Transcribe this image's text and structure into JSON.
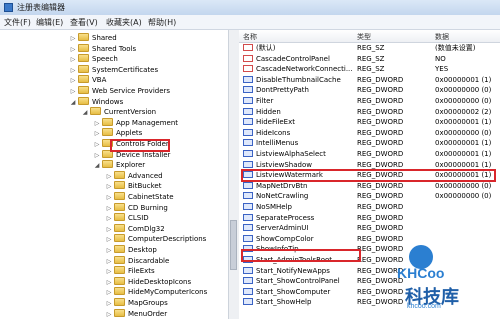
{
  "window": {
    "title": "注册表编辑器"
  },
  "menu": [
    "文件(F)",
    "编辑(E)",
    "查看(V)",
    "收藏夹(A)",
    "帮助(H)"
  ],
  "tree": [
    {
      "label": "Shared",
      "indent": 0
    },
    {
      "label": "Shared Tools",
      "indent": 0
    },
    {
      "label": "Speech",
      "indent": 0
    },
    {
      "label": "SystemCertificates",
      "indent": 0
    },
    {
      "label": "VBA",
      "indent": 0
    },
    {
      "label": "Web Service Providers",
      "indent": 0
    },
    {
      "label": "Windows",
      "indent": 0,
      "expanded": true
    },
    {
      "label": "CurrentVersion",
      "indent": 1,
      "expanded": true
    },
    {
      "label": "App Management",
      "indent": 2
    },
    {
      "label": "Applets",
      "indent": 2
    },
    {
      "label": "Controls Folder",
      "indent": 2
    },
    {
      "label": "Device Installer",
      "indent": 2
    },
    {
      "label": "Explorer",
      "indent": 2,
      "expanded": true
    },
    {
      "label": "Advanced",
      "indent": 3,
      "selected": true
    },
    {
      "label": "BitBucket",
      "indent": 3
    },
    {
      "label": "CabinetState",
      "indent": 3
    },
    {
      "label": "CD Burning",
      "indent": 3
    },
    {
      "label": "CLSID",
      "indent": 3
    },
    {
      "label": "ComDlg32",
      "indent": 3
    },
    {
      "label": "ComputerDescriptions",
      "indent": 3
    },
    {
      "label": "Desktop",
      "indent": 3
    },
    {
      "label": "Discardable",
      "indent": 3
    },
    {
      "label": "FileExts",
      "indent": 3
    },
    {
      "label": "HideDesktopIcons",
      "indent": 3
    },
    {
      "label": "HideMyComputerIcons",
      "indent": 3
    },
    {
      "label": "MapGroups",
      "indent": 3
    },
    {
      "label": "MenuOrder",
      "indent": 3
    }
  ],
  "list": {
    "headers": [
      "名称",
      "类型",
      "数据"
    ],
    "rows": [
      {
        "name": "(默认)",
        "type": "REG_SZ",
        "data": "(数值未设置)",
        "icon": "sz"
      },
      {
        "name": "CascadeControlPanel",
        "type": "REG_SZ",
        "data": "NO",
        "icon": "sz"
      },
      {
        "name": "CascadeNetworkConnecti...",
        "type": "REG_SZ",
        "data": "YES",
        "icon": "sz"
      },
      {
        "name": "DisableThumbnailCache",
        "type": "REG_DWORD",
        "data": "0x00000001 (1)",
        "icon": "dw"
      },
      {
        "name": "DontPrettyPath",
        "type": "REG_DWORD",
        "data": "0x00000000 (0)",
        "icon": "dw"
      },
      {
        "name": "Filter",
        "type": "REG_DWORD",
        "data": "0x00000000 (0)",
        "icon": "dw"
      },
      {
        "name": "Hidden",
        "type": "REG_DWORD",
        "data": "0x00000002 (2)",
        "icon": "dw"
      },
      {
        "name": "HideFileExt",
        "type": "REG_DWORD",
        "data": "0x00000001 (1)",
        "icon": "dw"
      },
      {
        "name": "HideIcons",
        "type": "REG_DWORD",
        "data": "0x00000000 (0)",
        "icon": "dw"
      },
      {
        "name": "IntelliMenus",
        "type": "REG_DWORD",
        "data": "0x00000001 (1)",
        "icon": "dw"
      },
      {
        "name": "ListviewAlphaSelect",
        "type": "REG_DWORD",
        "data": "0x00000001 (1)",
        "icon": "dw"
      },
      {
        "name": "ListviewShadow",
        "type": "REG_DWORD",
        "data": "0x00000001 (1)",
        "icon": "dw"
      },
      {
        "name": "ListviewWatermark",
        "type": "REG_DWORD",
        "data": "0x00000001 (1)",
        "icon": "dw"
      },
      {
        "name": "MapNetDrvBtn",
        "type": "REG_DWORD",
        "data": "0x00000000 (0)",
        "icon": "dw"
      },
      {
        "name": "NoNetCrawling",
        "type": "REG_DWORD",
        "data": "0x00000000 (0)",
        "icon": "dw"
      },
      {
        "name": "NoSMHelp",
        "type": "REG_DWORD",
        "data": "",
        "icon": "dw"
      },
      {
        "name": "SeparateProcess",
        "type": "REG_DWORD",
        "data": "",
        "icon": "dw"
      },
      {
        "name": "ServerAdminUI",
        "type": "REG_DWORD",
        "data": "",
        "icon": "dw"
      },
      {
        "name": "ShowCompColor",
        "type": "REG_DWORD",
        "data": "",
        "icon": "dw"
      },
      {
        "name": "ShowInfoTip",
        "type": "REG_DWORD",
        "data": "",
        "icon": "dw"
      },
      {
        "name": "Start_AdminToolsRoot",
        "type": "REG_DWORD",
        "data": "",
        "icon": "dw"
      },
      {
        "name": "Start_NotifyNewApps",
        "type": "REG_DWORD",
        "data": "",
        "icon": "dw"
      },
      {
        "name": "Start_ShowControlPanel",
        "type": "REG_DWORD",
        "data": "",
        "icon": "dw"
      },
      {
        "name": "Start_ShowComputer",
        "type": "REG_DWORD",
        "data": "",
        "icon": "dw"
      },
      {
        "name": "Start_ShowHelp",
        "type": "REG_DWORD",
        "data": "",
        "icon": "dw"
      }
    ]
  },
  "watermark": {
    "brand": "KHCoo",
    "cn": "科技库",
    "url": "khcoo.com"
  },
  "colors": {
    "highlight": "#d9262b",
    "accent": "#2b7fd1"
  }
}
